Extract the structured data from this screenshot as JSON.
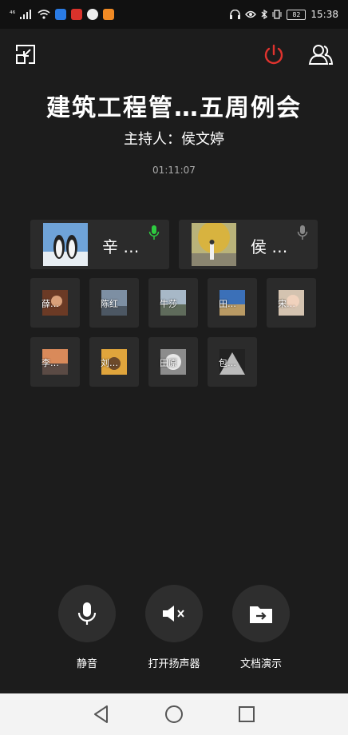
{
  "status": {
    "signal": "⁴⁶",
    "battery": "82",
    "time": "15:38"
  },
  "meeting": {
    "title": "建筑工程管…五周例会",
    "host": "主持人：侯文婷",
    "elapsed": "01:11:07"
  },
  "speakers": [
    {
      "name": "辛 …",
      "mic": "active",
      "mic_color": "#2ecc40"
    },
    {
      "name": "侯 …",
      "mic": "idle",
      "mic_color": "#888888"
    }
  ],
  "participants": [
    {
      "name": "薛…"
    },
    {
      "name": "陈红"
    },
    {
      "name": "牛莎"
    },
    {
      "name": "田…"
    },
    {
      "name": "宋…"
    },
    {
      "name": "李…"
    },
    {
      "name": "刘…"
    },
    {
      "name": "田原"
    },
    {
      "name": "包…"
    }
  ],
  "controls": {
    "mute": "静音",
    "speaker": "打开扬声器",
    "share": "文档演示"
  },
  "icons": {
    "exit_fullscreen": "shrink-icon",
    "end_call": "power-icon",
    "members": "members-icon"
  },
  "colors": {
    "end_call": "#e0332e",
    "background": "#1c1c1c",
    "tile": "#2b2b2b"
  }
}
